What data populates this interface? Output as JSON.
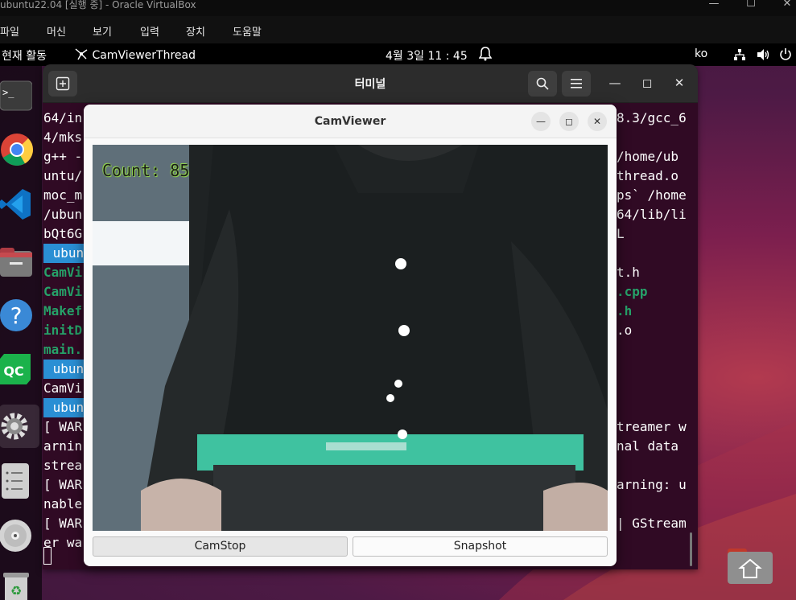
{
  "vbox": {
    "title": "ubuntu22.04 [실행 중] - Oracle VirtualBox",
    "minimize": "—",
    "maximize": "☐",
    "close": "✕",
    "menu": [
      "파일",
      "머신",
      "보기",
      "입력",
      "장치",
      "도움말"
    ]
  },
  "topbar": {
    "activities": "현재 활동",
    "app_name": "CamViewerThread",
    "datetime": "4월 3일  11 : 45",
    "input_method": "ko"
  },
  "dock": {
    "apps": [
      "terminal-icon",
      "chrome-icon",
      "vscode-icon",
      "files-icon",
      "help-icon",
      "qtcreator-icon",
      "settings-icon",
      "disk-utility-icon",
      "dvd-icon",
      "trash-icon"
    ],
    "qc_label": "QC",
    "help_label": "?"
  },
  "terminal": {
    "title": "터미널",
    "left_lines": [
      "64/in",
      "4/mks",
      "g++ -",
      "untu/",
      "moc_m",
      "/ubun",
      "bQt6G",
      " ubun",
      "CamVi",
      "CamVi",
      "Makef",
      "initD",
      "main.",
      " ubun",
      "CamVi",
      " ubun",
      "[ WAR",
      "arnin",
      "strea",
      "[ WAR",
      "nable",
      "[ WAR",
      "er wa"
    ],
    "right_lines": [
      "8.3/gcc_6",
      "",
      "/home/ub",
      "thread.o",
      "ps` /home",
      "64/lib/li",
      "L",
      "",
      "t.h",
      ".cpp",
      ".h",
      ".o",
      "",
      "",
      "",
      "",
      "treamer w",
      "nal data",
      "",
      "arning: u",
      "",
      "| GStream",
      ""
    ]
  },
  "camviewer": {
    "title": "CamViewer",
    "count_label": "Count: 85",
    "buttons": {
      "camstop": "CamStop",
      "snapshot": "Snapshot"
    }
  }
}
